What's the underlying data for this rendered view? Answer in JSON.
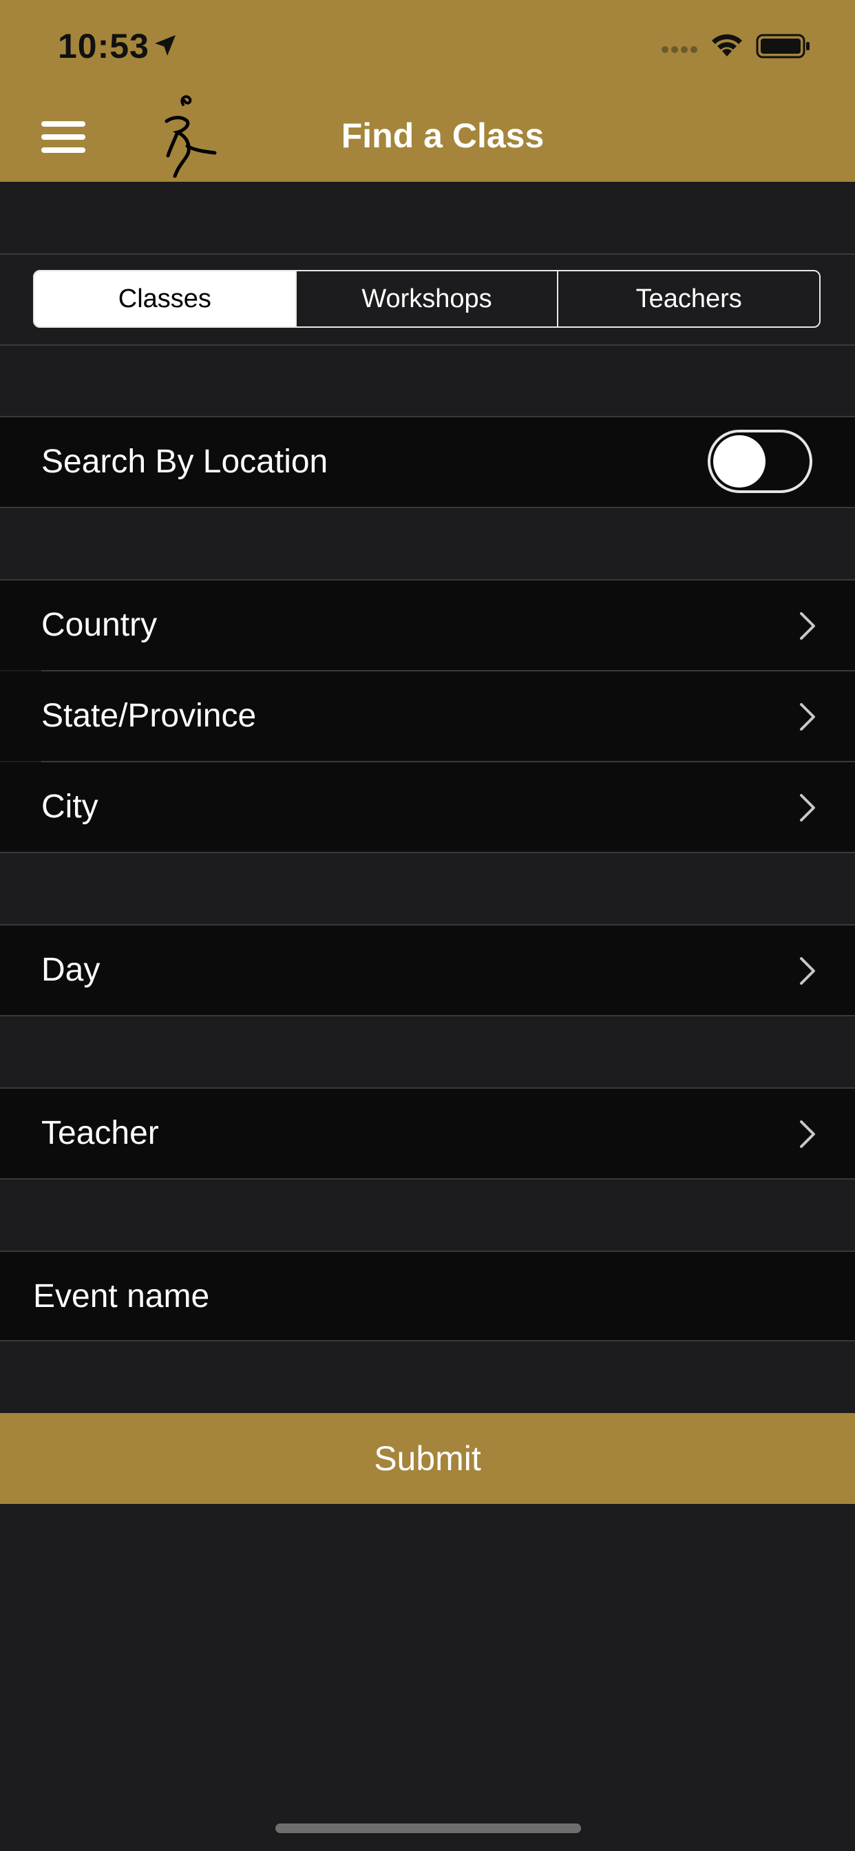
{
  "status_bar": {
    "time": "10:53",
    "location_icon": "location-arrow-icon",
    "signal_icon": "signal-icon",
    "wifi_icon": "wifi-icon",
    "battery_icon": "battery-icon"
  },
  "nav": {
    "title": "Find a Class",
    "menu_icon": "hamburger-menu-icon",
    "logo_icon": "dancer-logo-icon"
  },
  "segments": [
    {
      "label": "Classes",
      "selected": true
    },
    {
      "label": "Workshops",
      "selected": false
    },
    {
      "label": "Teachers",
      "selected": false
    }
  ],
  "location_toggle": {
    "label": "Search By Location",
    "on": false
  },
  "location_fields": [
    {
      "label": "Country"
    },
    {
      "label": "State/Province"
    },
    {
      "label": "City"
    }
  ],
  "day_field": {
    "label": "Day"
  },
  "teacher_field": {
    "label": "Teacher"
  },
  "event_name": {
    "placeholder": "Event name",
    "value": ""
  },
  "submit": {
    "label": "Submit"
  },
  "colors": {
    "accent": "#a5853b",
    "background": "#1c1c1e",
    "cell_background": "#0b0b0b",
    "text": "#ffffff"
  }
}
